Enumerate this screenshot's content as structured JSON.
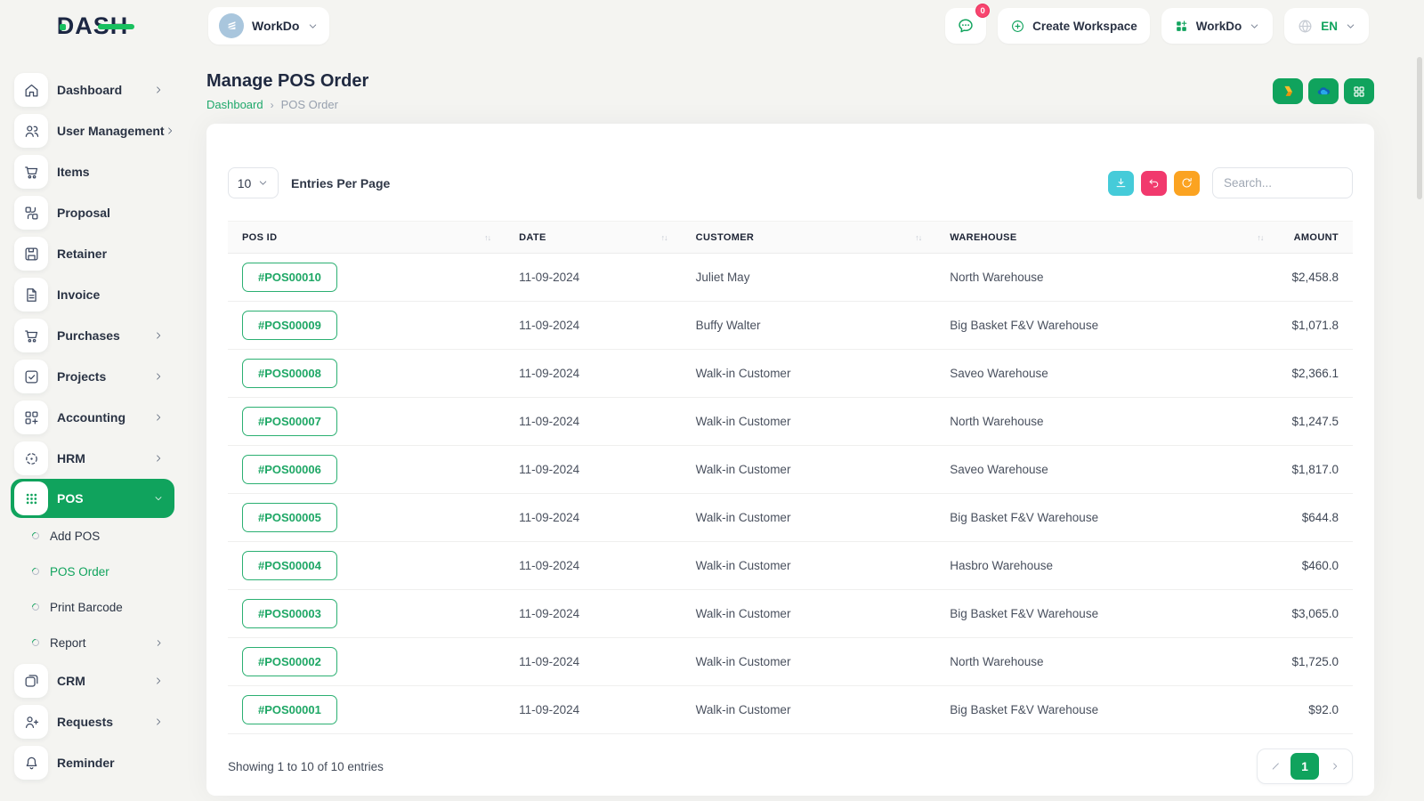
{
  "colors": {
    "primary_green": "#10a35d",
    "link_green": "#1fa86b",
    "teal_button": "#45cbd9",
    "pink_button": "#f1396d",
    "orange_button": "#fba321",
    "badge_red": "#f8456f"
  },
  "brand": {
    "logo_text": "DASH"
  },
  "header": {
    "workspace_pill": {
      "label": "WorkDo",
      "icon": "building-icon"
    },
    "messages": {
      "icon": "chat-icon",
      "badge": "0"
    },
    "create_workspace": {
      "label": "Create Workspace",
      "icon": "plus-circle-icon"
    },
    "workspace_dropdown": {
      "label": "WorkDo",
      "icon": "workdo-grid-icon"
    },
    "language": {
      "label": "EN",
      "icon": "globe-icon"
    }
  },
  "page": {
    "title": "Manage POS Order",
    "breadcrumb": [
      "Dashboard",
      "POS Order"
    ],
    "quick_action_icons": [
      "google-drive-icon",
      "onedrive-icon",
      "grid-icon"
    ]
  },
  "sidebar": {
    "items": [
      {
        "label": "Dashboard",
        "icon": "home-icon",
        "chevron": "right"
      },
      {
        "label": "User Management",
        "icon": "users-icon",
        "chevron": "right"
      },
      {
        "label": "Items",
        "icon": "cart-icon"
      },
      {
        "label": "Proposal",
        "icon": "proposal-icon"
      },
      {
        "label": "Retainer",
        "icon": "retainer-icon"
      },
      {
        "label": "Invoice",
        "icon": "invoice-icon"
      },
      {
        "label": "Purchases",
        "icon": "cart-icon",
        "chevron": "right"
      },
      {
        "label": "Projects",
        "icon": "projects-icon",
        "chevron": "right"
      },
      {
        "label": "Accounting",
        "icon": "accounting-icon",
        "chevron": "right"
      },
      {
        "label": "HRM",
        "icon": "hrm-icon",
        "chevron": "right"
      },
      {
        "label": "POS",
        "icon": "pos-grid-icon",
        "chevron": "down",
        "active": true,
        "children": [
          {
            "label": "Add POS"
          },
          {
            "label": "POS Order",
            "active": true
          },
          {
            "label": "Print Barcode"
          },
          {
            "label": "Report",
            "chevron": "right"
          }
        ]
      },
      {
        "label": "CRM",
        "icon": "crm-icon",
        "chevron": "right"
      },
      {
        "label": "Requests",
        "icon": "user-plus-icon",
        "chevron": "right"
      },
      {
        "label": "Reminder",
        "icon": "bell-icon"
      }
    ]
  },
  "table": {
    "entries_per_page": {
      "value": "10",
      "label": "Entries Per Page"
    },
    "toolbar_icons": [
      "download-icon",
      "undo-icon",
      "refresh-icon"
    ],
    "search_placeholder": "Search...",
    "sort_glyph": "↑↓",
    "columns": [
      {
        "label": "POS ID",
        "sortable": true
      },
      {
        "label": "DATE",
        "sortable": true
      },
      {
        "label": "CUSTOMER",
        "sortable": true
      },
      {
        "label": "WAREHOUSE",
        "sortable": true
      },
      {
        "label": "AMOUNT",
        "sortable": false
      }
    ],
    "rows": [
      {
        "pos_id": "#POS00010",
        "date": "11-09-2024",
        "customer": "Juliet May",
        "warehouse": "North Warehouse",
        "amount": "$2,458.8"
      },
      {
        "pos_id": "#POS00009",
        "date": "11-09-2024",
        "customer": "Buffy Walter",
        "warehouse": "Big Basket F&V Warehouse",
        "amount": "$1,071.8"
      },
      {
        "pos_id": "#POS00008",
        "date": "11-09-2024",
        "customer": "Walk-in Customer",
        "warehouse": "Saveo Warehouse",
        "amount": "$2,366.1"
      },
      {
        "pos_id": "#POS00007",
        "date": "11-09-2024",
        "customer": "Walk-in Customer",
        "warehouse": "North Warehouse",
        "amount": "$1,247.5"
      },
      {
        "pos_id": "#POS00006",
        "date": "11-09-2024",
        "customer": "Walk-in Customer",
        "warehouse": "Saveo Warehouse",
        "amount": "$1,817.0"
      },
      {
        "pos_id": "#POS00005",
        "date": "11-09-2024",
        "customer": "Walk-in Customer",
        "warehouse": "Big Basket F&V Warehouse",
        "amount": "$644.8"
      },
      {
        "pos_id": "#POS00004",
        "date": "11-09-2024",
        "customer": "Walk-in Customer",
        "warehouse": "Hasbro Warehouse",
        "amount": "$460.0"
      },
      {
        "pos_id": "#POS00003",
        "date": "11-09-2024",
        "customer": "Walk-in Customer",
        "warehouse": "Big Basket F&V Warehouse",
        "amount": "$3,065.0"
      },
      {
        "pos_id": "#POS00002",
        "date": "11-09-2024",
        "customer": "Walk-in Customer",
        "warehouse": "North Warehouse",
        "amount": "$1,725.0"
      },
      {
        "pos_id": "#POS00001",
        "date": "11-09-2024",
        "customer": "Walk-in Customer",
        "warehouse": "Big Basket F&V Warehouse",
        "amount": "$92.0"
      }
    ],
    "footer": {
      "summary": "Showing 1 to 10 of 10 entries",
      "current_page": "1"
    }
  }
}
